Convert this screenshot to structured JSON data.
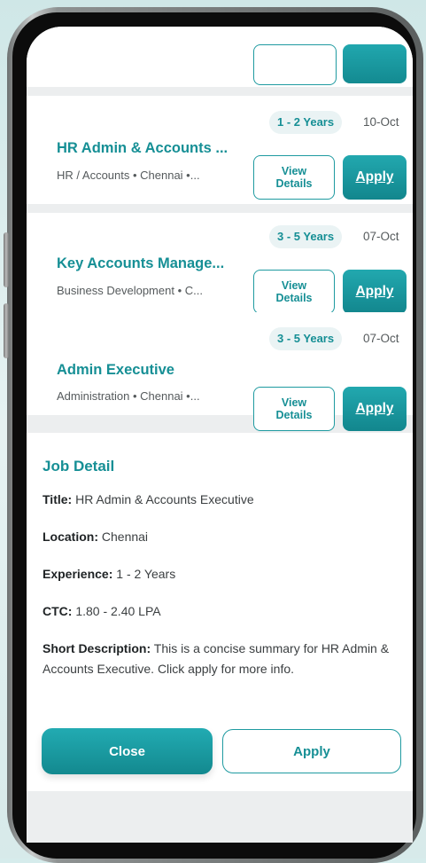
{
  "jobs": [
    {
      "title": "HR Admin & Accounts ...",
      "meta": "HR / Accounts • Chennai •...",
      "experience": "1 - 2 Years",
      "date": "10-Oct"
    },
    {
      "title": "Key Accounts Manage...",
      "meta": "Business Development • C...",
      "experience": "3 - 5 Years",
      "date": "07-Oct"
    },
    {
      "title": "Admin Executive",
      "meta": "Administration • Chennai •...",
      "experience": "3 - 5 Years",
      "date": "07-Oct"
    }
  ],
  "buttons": {
    "view_line1": "View",
    "view_line2": "Details",
    "apply": "Apply"
  },
  "detail": {
    "heading": "Job Detail",
    "title_label": "Title:",
    "title_value": "HR Admin & Accounts Executive",
    "location_label": "Location:",
    "location_value": "Chennai",
    "experience_label": "Experience:",
    "experience_value": "1 - 2 Years",
    "ctc_label": "CTC:",
    "ctc_value": "1.80 - 2.40 LPA",
    "desc_label": "Short Description:",
    "desc_value": "This is a concise summary for HR Admin & Accounts Executive. Click apply for more info.",
    "close_label": "Close",
    "apply_label": "Apply"
  },
  "colors": {
    "accent": "#168f95",
    "accent_button": "#1a9aa1",
    "background": "#eceeef"
  }
}
